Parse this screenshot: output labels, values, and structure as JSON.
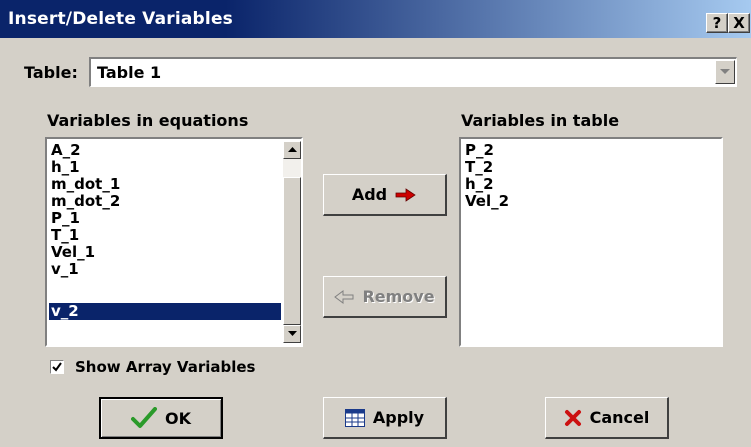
{
  "window": {
    "title": "Insert/Delete Variables",
    "help_glyph": "?",
    "close_glyph": "X"
  },
  "table_selector": {
    "label": "Table:",
    "value": "Table 1"
  },
  "equations_list": {
    "label": "Variables in equations",
    "items": [
      "A_2",
      "h_1",
      "m_dot_1",
      "m_dot_2",
      "P_1",
      "T_1",
      "Vel_1",
      "v_1",
      "v_2"
    ],
    "selected_index": 8
  },
  "table_list": {
    "label": "Variables in table",
    "items": [
      "P_2",
      "T_2",
      "h_2",
      "Vel_2"
    ]
  },
  "buttons": {
    "add": "Add",
    "remove": "Remove",
    "ok": "OK",
    "apply": "Apply",
    "cancel": "Cancel"
  },
  "show_array_variables": {
    "label": "Show Array Variables",
    "checked": true
  },
  "colors": {
    "titlebar": "#0a246a",
    "selection": "#0a246a",
    "add_arrow": "#cc0000",
    "ok_check": "#2a9a2a",
    "cancel_x": "#cc1111"
  }
}
